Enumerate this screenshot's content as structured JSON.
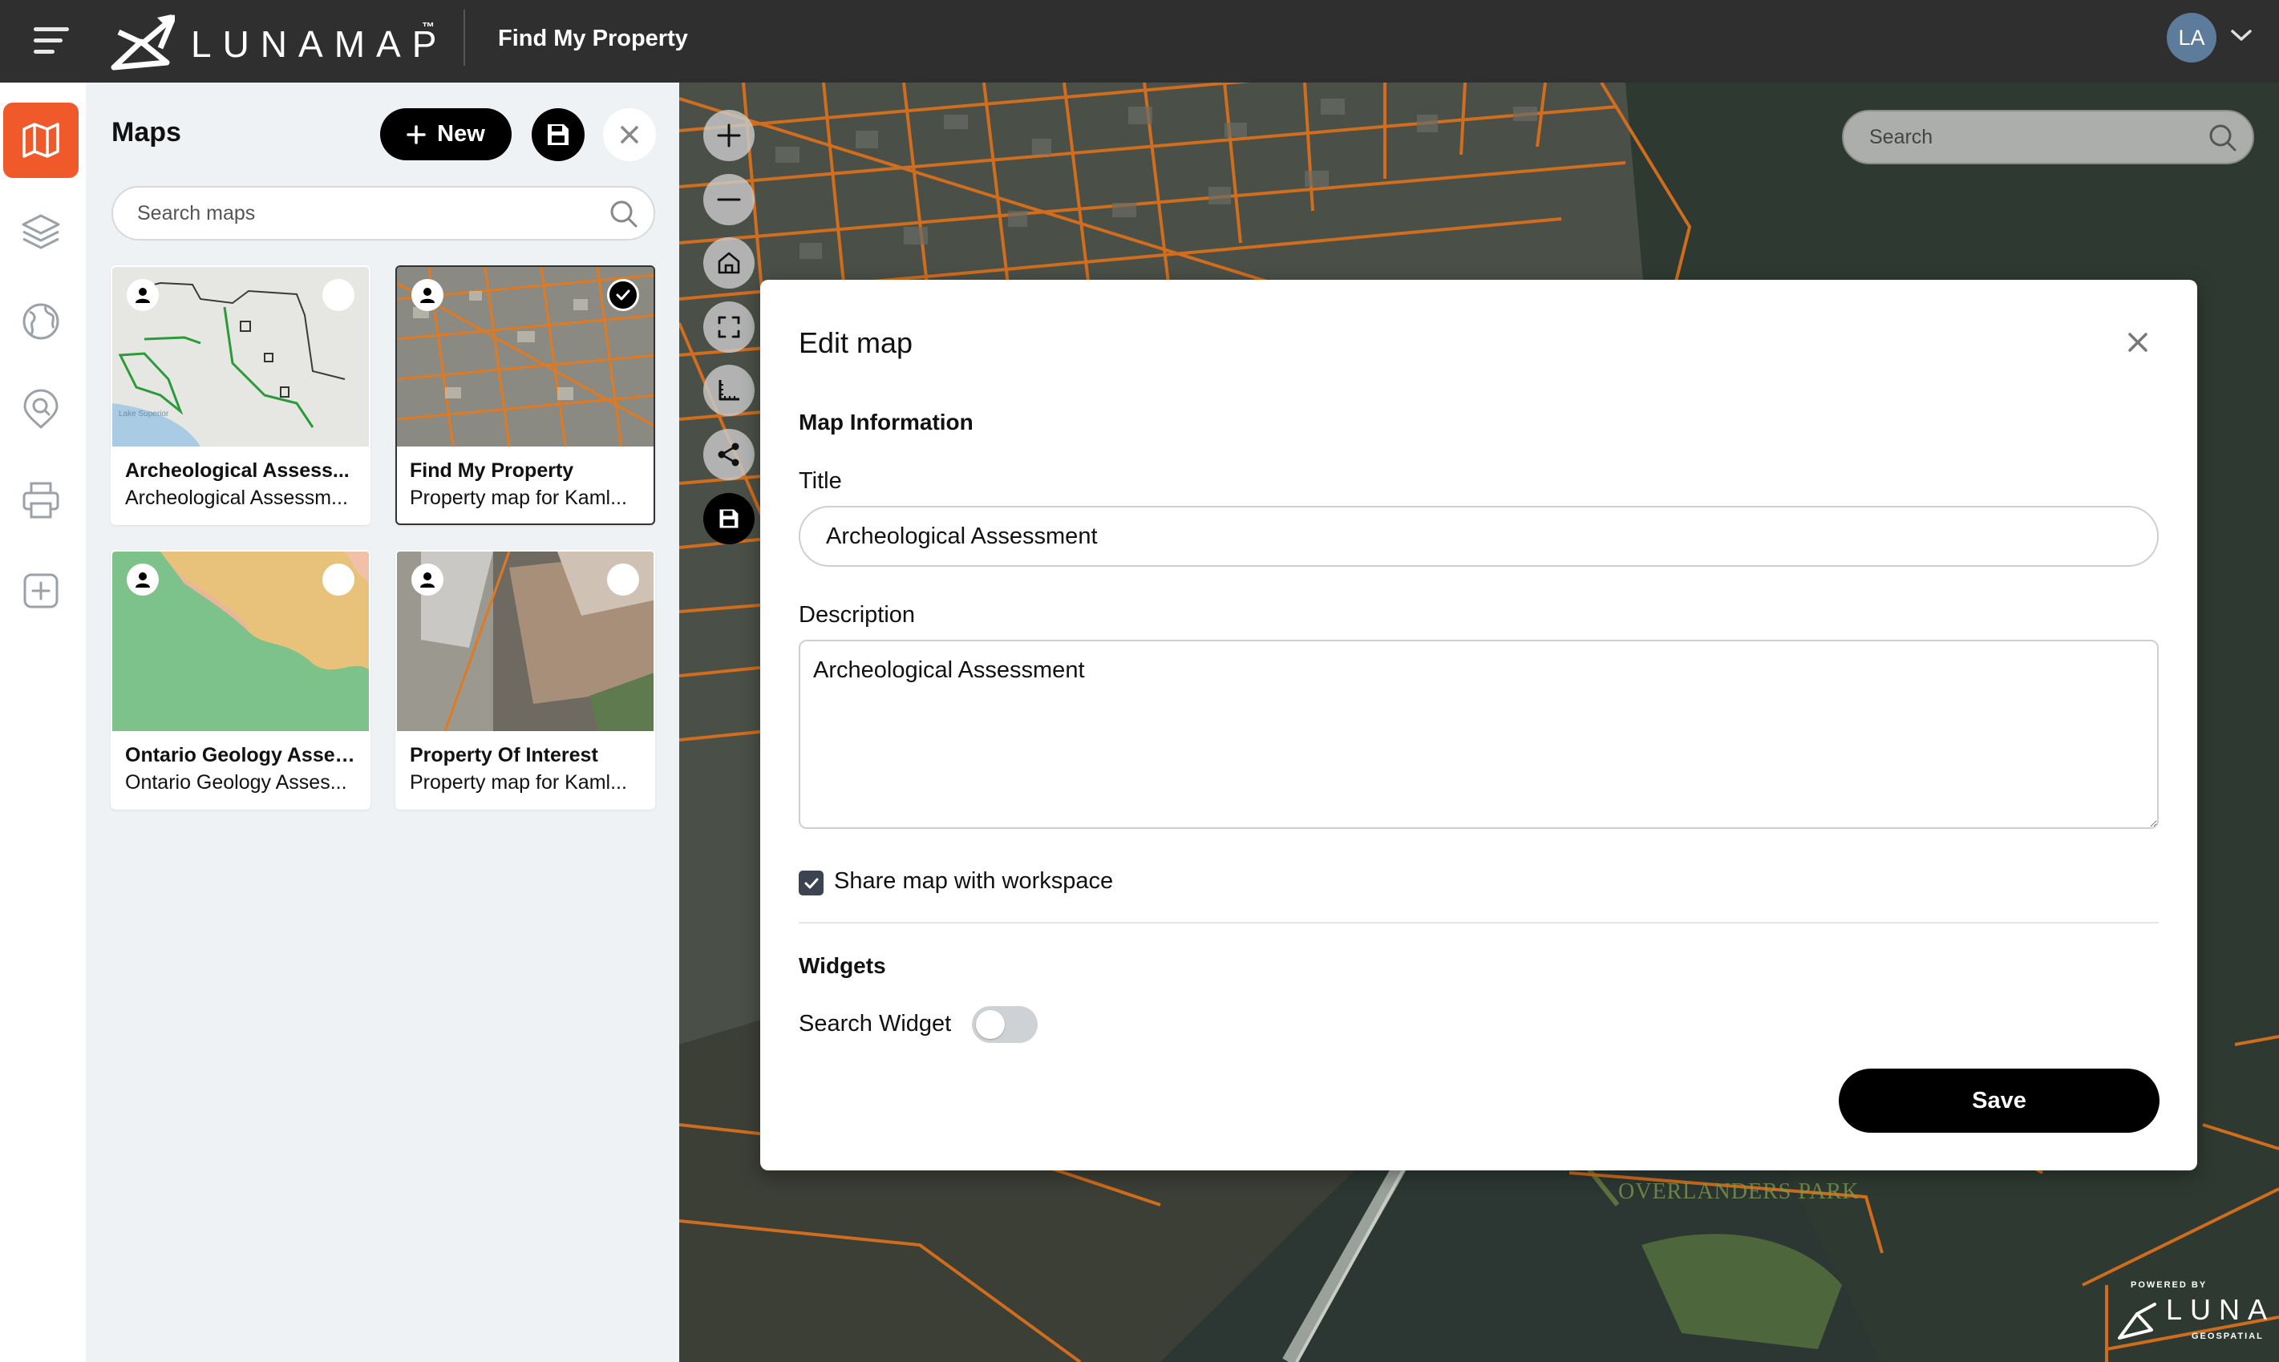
{
  "topbar": {
    "brand": "LUNAMAP",
    "brand_tm": "™",
    "app_title": "Find My Property",
    "user_initials": "LA"
  },
  "rail": {
    "items": [
      {
        "name": "maps",
        "icon": "map-icon",
        "active": true
      },
      {
        "name": "layers",
        "icon": "layers-icon",
        "active": false
      },
      {
        "name": "basemaps",
        "icon": "globe-icon",
        "active": false
      },
      {
        "name": "search",
        "icon": "location-search-icon",
        "active": false
      },
      {
        "name": "print",
        "icon": "printer-icon",
        "active": false
      },
      {
        "name": "add",
        "icon": "add-square-icon",
        "active": false
      }
    ]
  },
  "maps_panel": {
    "title": "Maps",
    "new_label": "New",
    "search_placeholder": "Search maps",
    "cards": [
      {
        "title": "Archeological Assess...",
        "description": "Archeological Assessm...",
        "selected": false,
        "thumb_label": "Lake Superior"
      },
      {
        "title": "Find My Property",
        "description": "Property map for Kaml...",
        "selected": true
      },
      {
        "title": "Ontario Geology Asses...",
        "description": "Ontario Geology Asses...",
        "selected": false
      },
      {
        "title": "Property Of Interest",
        "description": "Property map for Kaml...",
        "selected": false
      }
    ]
  },
  "map": {
    "search_placeholder": "Search",
    "park_label": "OVERLANDERS PARK",
    "controls": [
      "zoom-in-icon",
      "zoom-out-icon",
      "home-icon",
      "fullscreen-icon",
      "measure-icon",
      "share-icon",
      "save-icon"
    ],
    "badge": {
      "powered_by": "POWERED BY",
      "name": "LUNA",
      "sub": "GEOSPATIAL"
    },
    "parcel_color": "#d86f1c"
  },
  "modal": {
    "title": "Edit map",
    "section_info": "Map Information",
    "title_label": "Title",
    "title_value": "Archeological Assessment",
    "description_label": "Description",
    "description_value": "Archeological Assessment",
    "share_label": "Share map with workspace",
    "share_checked": true,
    "section_widgets": "Widgets",
    "search_widget_label": "Search Widget",
    "search_widget_on": false,
    "save_label": "Save"
  },
  "colors": {
    "accent": "#f0592a",
    "topbar": "#2f2f2f",
    "panel_bg": "#eff2f5",
    "avatar": "#5d7c9c"
  }
}
